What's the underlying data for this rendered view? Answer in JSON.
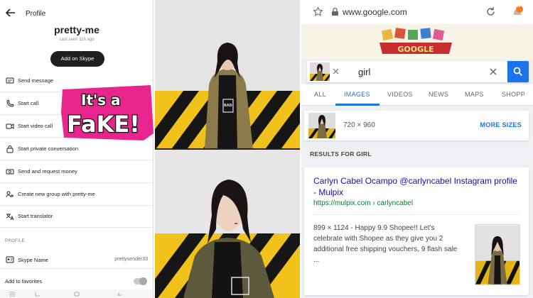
{
  "skype": {
    "header_title": "Profile",
    "name": "pretty-me",
    "last_seen": "Last seen 11h ago",
    "add_button": "Add on Skype",
    "actions": [
      {
        "label": "Send message",
        "icon": "message-icon"
      },
      {
        "label": "Start call",
        "icon": "phone-icon"
      },
      {
        "label": "Start video call",
        "icon": "video-icon"
      },
      {
        "label": "Start private conversation",
        "icon": "lock-icon"
      },
      {
        "label": "Send and request money",
        "icon": "money-icon"
      },
      {
        "label": "Create new group with pretty-me",
        "icon": "group-icon"
      },
      {
        "label": "Start translator",
        "icon": "translate-icon"
      }
    ],
    "section_label": "PROFILE",
    "skype_name_label": "Skype Name",
    "skype_name_value": "prettysender33",
    "favorites_label": "Add to favorites"
  },
  "sticker": {
    "line1": "It's a",
    "line2": "FaKE!",
    "color": "#e8258d"
  },
  "google": {
    "url": "www.google.com",
    "notification_letter": "N",
    "doodle_text": "GOOGLE",
    "query": "girl",
    "tabs": [
      "ALL",
      "IMAGES",
      "VIDEOS",
      "NEWS",
      "MAPS",
      "SHOPP"
    ],
    "active_tab": "IMAGES",
    "image_size": "720 × 960",
    "more_sizes": "MORE SIZES",
    "results_for": "RESULTS FOR GIRL",
    "result": {
      "title": "Carlyn Cabel Ocampo @carlyncabel Instagram profile - Mulpix",
      "url": "https://mulpix.com › carlyncabel",
      "snippet": "899 × 1124 - Happy 9.9 Shopee!! Let's celebrate with Shopee as they give you 2 additional free shipping vouchers, 9 flash sale ..."
    },
    "accent": "#1a73e8"
  },
  "photo_shirt_text": "BAD"
}
